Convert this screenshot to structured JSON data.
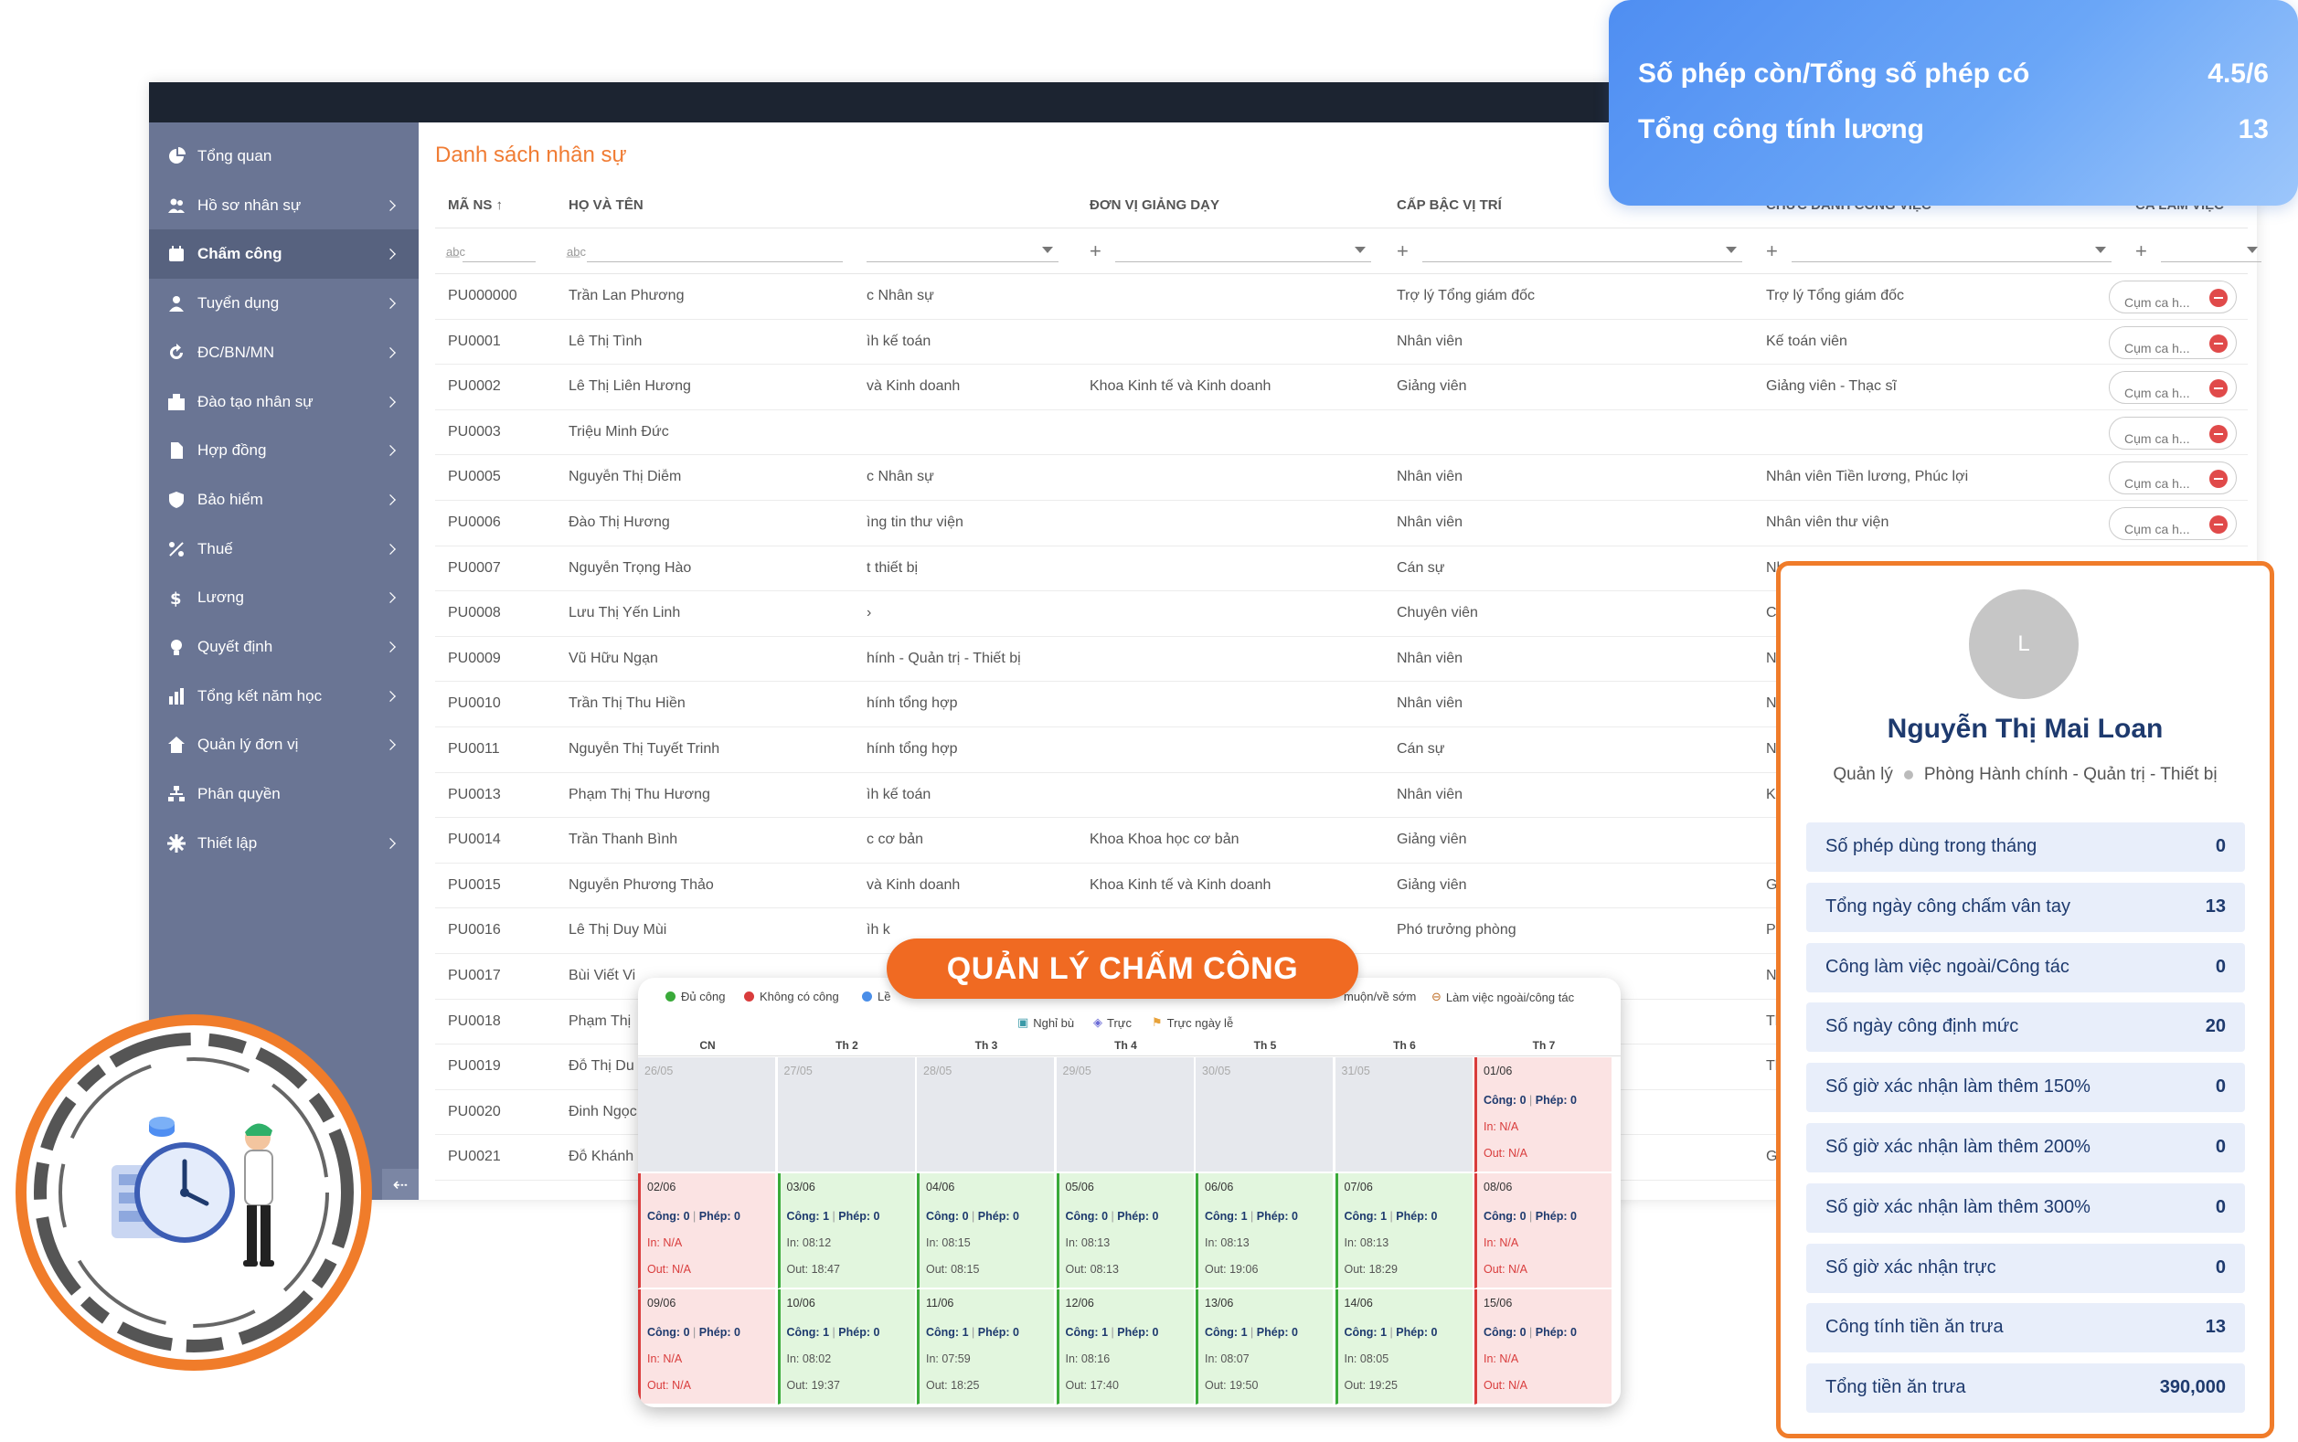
{
  "summary": {
    "row1_label": "Số phép còn/Tổng số phép có",
    "row1_value": "4.5/6",
    "row2_label": "Tổng công tính lương",
    "row2_value": "13"
  },
  "sidebar": {
    "items": [
      {
        "label": "Tổng quan",
        "icon": "pie-chart-icon",
        "chevron": false
      },
      {
        "label": "Hồ sơ nhân sự",
        "icon": "users-icon",
        "chevron": true
      },
      {
        "label": "Chấm công",
        "icon": "calendar-icon",
        "chevron": true,
        "active": true
      },
      {
        "label": "Tuyển dụng",
        "icon": "user-icon",
        "chevron": true
      },
      {
        "label": "ĐC/BN/MN",
        "icon": "refresh-icon",
        "chevron": true
      },
      {
        "label": "Đào tạo nhân sự",
        "icon": "building-icon",
        "chevron": true
      },
      {
        "label": "Hợp đồng",
        "icon": "document-icon",
        "chevron": true
      },
      {
        "label": "Bảo hiểm",
        "icon": "shield-icon",
        "chevron": true
      },
      {
        "label": "Thuế",
        "icon": "percent-icon",
        "chevron": true
      },
      {
        "label": "Lương",
        "icon": "dollar-icon",
        "chevron": true
      },
      {
        "label": "Quyết định",
        "icon": "bulb-icon",
        "chevron": true
      },
      {
        "label": "Tổng kết năm học",
        "icon": "chart-icon",
        "chevron": true
      },
      {
        "label": "Quản lý đơn vị",
        "icon": "home-icon",
        "chevron": true
      },
      {
        "label": "Phân quyền",
        "icon": "sitemap-icon",
        "chevron": false
      },
      {
        "label": "Thiết lập",
        "icon": "gear-icon",
        "chevron": true
      }
    ],
    "collapse_glyph": "⇠"
  },
  "page": {
    "title": "Danh sách nhân sự"
  },
  "table": {
    "headers": {
      "ma_ns": "MÃ NS",
      "ma_ns_sort": "↑",
      "ho_ten": "HỌ VÀ TÊN",
      "don_vi": "ĐƠN VỊ GIẢNG DẠY",
      "cap_bac": "CẤP BẬC VỊ TRÍ",
      "chuc_danh": "CHỨC DANH CÔNG VIỆC",
      "ca_lam": "CA LÀM VIỆC"
    },
    "rows": [
      {
        "ma": "PU000000",
        "ten": "Trần Lan Phương",
        "phong": "c Nhân sự",
        "don_vi": "",
        "cap_bac": "Trợ lý Tổng giám đốc",
        "chuc_danh": "Trợ lý Tổng giám đốc",
        "ca": "Cụm ca h..."
      },
      {
        "ma": "PU0001",
        "ten": "Lê Thị Tình",
        "phong": "ìh kế toán",
        "don_vi": "",
        "cap_bac": "Nhân viên",
        "chuc_danh": "Kế toán viên",
        "ca": "Cụm ca h..."
      },
      {
        "ma": "PU0002",
        "ten": "Lê Thị Liên Hương",
        "phong": "và Kinh doanh",
        "don_vi": "Khoa Kinh tế và Kinh doanh",
        "cap_bac": "Giảng viên",
        "chuc_danh": "Giảng viên - Thạc sĩ",
        "ca": "Cụm ca h..."
      },
      {
        "ma": "PU0003",
        "ten": "Triệu Minh Đức",
        "phong": "",
        "don_vi": "",
        "cap_bac": "",
        "chuc_danh": "",
        "ca": "Cụm ca h..."
      },
      {
        "ma": "PU0005",
        "ten": "Nguyễn Thị Diễm",
        "phong": "c Nhân sự",
        "don_vi": "",
        "cap_bac": "Nhân viên",
        "chuc_danh": "Nhân viên Tiền lương, Phúc lợi",
        "ca": "Cụm ca h..."
      },
      {
        "ma": "PU0006",
        "ten": "Đào Thị Hương",
        "phong": "ìng tin thư viện",
        "don_vi": "",
        "cap_bac": "Nhân viên",
        "chuc_danh": "Nhân viên thư viện",
        "ca": "Cụm ca h..."
      },
      {
        "ma": "PU0007",
        "ten": "Nguyễn Trọng Hào",
        "phong": "t thiết bị",
        "don_vi": "",
        "cap_bac": "Cán sự",
        "chuc_danh": "Nh",
        "ca": ""
      },
      {
        "ma": "PU0008",
        "ten": "Lưu Thị Yến Linh",
        "phong": "›",
        "don_vi": "",
        "cap_bac": "Chuyên viên",
        "chuc_danh": "Ch",
        "ca": ""
      },
      {
        "ma": "PU0009",
        "ten": "Vũ Hữu Ngạn",
        "phong": "hính - Quản trị - Thiết bị",
        "don_vi": "",
        "cap_bac": "Nhân viên",
        "chuc_danh": "Nh",
        "ca": ""
      },
      {
        "ma": "PU0010",
        "ten": "Trần Thị Thu Hiền",
        "phong": "hính tổng hợp",
        "don_vi": "",
        "cap_bac": "Nhân viên",
        "chuc_danh": "Nh",
        "ca": ""
      },
      {
        "ma": "PU0011",
        "ten": "Nguyễn Thị Tuyết Trinh",
        "phong": "hính tổng hợp",
        "don_vi": "",
        "cap_bac": "Cán sự",
        "chuc_danh": "Nh",
        "ca": ""
      },
      {
        "ma": "PU0013",
        "ten": "Phạm Thị Thu Hương",
        "phong": "ìh kế toán",
        "don_vi": "",
        "cap_bac": "Nhân viên",
        "chuc_danh": "Kế",
        "ca": ""
      },
      {
        "ma": "PU0014",
        "ten": "Trần Thanh Bình",
        "phong": "c cơ bản",
        "don_vi": "Khoa Khoa học cơ bản",
        "cap_bac": "Giảng viên",
        "chuc_danh": "",
        "ca": ""
      },
      {
        "ma": "PU0015",
        "ten": "Nguyễn Phương Thảo",
        "phong": "và Kinh doanh",
        "don_vi": "Khoa Kinh tế và Kinh doanh",
        "cap_bac": "Giảng viên",
        "chuc_danh": "Giả",
        "ca": ""
      },
      {
        "ma": "PU0016",
        "ten": "Lê Thị Duy Mùi",
        "phong": "ìh k",
        "don_vi": "",
        "cap_bac": "Phó trưởng phòng",
        "chuc_danh": "Ph",
        "ca": ""
      },
      {
        "ma": "PU0017",
        "ten": "Bùi Viết Vi",
        "phong": "",
        "don_vi": "",
        "cap_bac": "",
        "chuc_danh": "Nh",
        "ca": ""
      },
      {
        "ma": "PU0018",
        "ten": "Phạm Thị",
        "phong": "",
        "don_vi": "",
        "cap_bac": "",
        "chuc_danh": "Th",
        "ca": ""
      },
      {
        "ma": "PU0019",
        "ten": "Đỗ Thị Du",
        "phong": "",
        "don_vi": "",
        "cap_bac": "",
        "chuc_danh": "Th",
        "ca": ""
      },
      {
        "ma": "PU0020",
        "ten": "Đinh Ngọc",
        "phong": "",
        "don_vi": "",
        "cap_bac": "",
        "chuc_danh": "",
        "ca": ""
      },
      {
        "ma": "PU0021",
        "ten": "Đỗ Khánh",
        "phong": "",
        "don_vi": "",
        "cap_bac": "",
        "chuc_danh": "Gia",
        "ca": ""
      }
    ]
  },
  "profile": {
    "avatar_letter": "L",
    "name": "Nguyễn Thị Mai Loan",
    "role": "Quản lý",
    "department": "Phòng Hành chính - Quản trị - Thiết bị",
    "stats": [
      {
        "label": "Số phép dùng trong tháng",
        "value": "0"
      },
      {
        "label": "Tổng ngày công chấm vân tay",
        "value": "13"
      },
      {
        "label": "Công làm việc ngoài/Công tác",
        "value": "0"
      },
      {
        "label": "Số ngày công định mức",
        "value": "20"
      },
      {
        "label": "Số giờ xác nhận làm thêm 150%",
        "value": "0"
      },
      {
        "label": "Số giờ xác nhận làm thêm 200%",
        "value": "0"
      },
      {
        "label": "Số giờ xác nhận làm thêm 300%",
        "value": "0"
      },
      {
        "label": "Số giờ xác nhận trực",
        "value": "0"
      },
      {
        "label": "Công tính tiền ăn trưa",
        "value": "13"
      },
      {
        "label": "Tổng tiền ăn trưa",
        "value": "390,000"
      }
    ]
  },
  "banner": {
    "text": "QUẢN LÝ CHẤM CÔNG"
  },
  "calendar": {
    "legend": {
      "du_cong": "Đủ công",
      "khong_cong": "Không có công",
      "le_partial": "Lề",
      "muon_som": "muộn/về sớm",
      "ngoai": "Làm việc ngoài/công tác",
      "nghi_bu": "Nghỉ bù",
      "truc": "Trực",
      "truc_le": "Trực ngày lễ"
    },
    "legend_colors": {
      "du_cong": "#3aaa3a",
      "khong_cong": "#d93c3c",
      "le": "#4a8ee8"
    },
    "weekdays": [
      "CN",
      "Th 2",
      "Th 3",
      "Th 4",
      "Th 5",
      "Th 6",
      "Th 7"
    ],
    "labels": {
      "cong": "Công:",
      "phep": "Phép:",
      "in": "In:",
      "out": "Out:"
    },
    "weeks": [
      [
        {
          "date": "26/05",
          "type": "empty"
        },
        {
          "date": "27/05",
          "type": "empty"
        },
        {
          "date": "28/05",
          "type": "empty"
        },
        {
          "date": "29/05",
          "type": "empty"
        },
        {
          "date": "30/05",
          "type": "empty"
        },
        {
          "date": "31/05",
          "type": "empty"
        },
        {
          "date": "01/06",
          "type": "red",
          "cong": "0",
          "phep": "0",
          "in": "N/A",
          "out": "N/A"
        }
      ],
      [
        {
          "date": "02/06",
          "type": "red",
          "cong": "0",
          "phep": "0",
          "in": "N/A",
          "out": "N/A"
        },
        {
          "date": "03/06",
          "type": "green",
          "cong": "1",
          "phep": "0",
          "in": "08:12",
          "out": "18:47"
        },
        {
          "date": "04/06",
          "type": "green",
          "cong": "0",
          "phep": "0",
          "in": "08:15",
          "out": "08:15"
        },
        {
          "date": "05/06",
          "type": "green",
          "cong": "0",
          "phep": "0",
          "in": "08:13",
          "out": "08:13"
        },
        {
          "date": "06/06",
          "type": "green",
          "cong": "1",
          "phep": "0",
          "in": "08:13",
          "out": "19:06"
        },
        {
          "date": "07/06",
          "type": "green",
          "cong": "1",
          "phep": "0",
          "in": "08:13",
          "out": "18:29"
        },
        {
          "date": "08/06",
          "type": "red",
          "cong": "0",
          "phep": "0",
          "in": "N/A",
          "out": "N/A"
        }
      ],
      [
        {
          "date": "09/06",
          "type": "red",
          "cong": "0",
          "phep": "0",
          "in": "N/A",
          "out": "N/A"
        },
        {
          "date": "10/06",
          "type": "green",
          "cong": "1",
          "phep": "0",
          "in": "08:02",
          "out": "19:37"
        },
        {
          "date": "11/06",
          "type": "green",
          "cong": "1",
          "phep": "0",
          "in": "07:59",
          "out": "18:25"
        },
        {
          "date": "12/06",
          "type": "green",
          "cong": "1",
          "phep": "0",
          "in": "08:16",
          "out": "17:40"
        },
        {
          "date": "13/06",
          "type": "green",
          "cong": "1",
          "phep": "0",
          "in": "08:07",
          "out": "19:50"
        },
        {
          "date": "14/06",
          "type": "green",
          "cong": "1",
          "phep": "0",
          "in": "08:05",
          "out": "19:25"
        },
        {
          "date": "15/06",
          "type": "red",
          "cong": "0",
          "phep": "0",
          "in": "N/A",
          "out": "N/A"
        }
      ]
    ]
  }
}
